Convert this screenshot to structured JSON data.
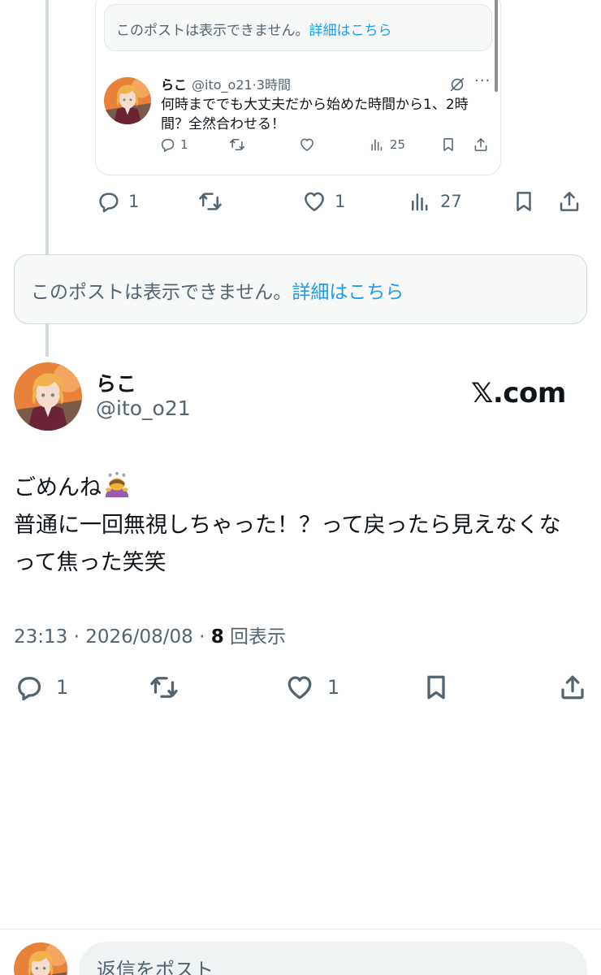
{
  "quoted_card": {
    "unavailable_text": "このポストは表示できません。",
    "unavailable_link": "詳細はこちら",
    "name": "らこ",
    "handle": "@ito_o21",
    "time": "3時間",
    "text": "何時まででも大丈夫だから始めた時間から1、2時間？全然合わせる！",
    "replies": "1",
    "views": "25"
  },
  "post1_actions": {
    "replies": "1",
    "likes": "1",
    "views": "27"
  },
  "unavailable_post": {
    "text": "このポストは表示できません。",
    "link": "詳細はこちら"
  },
  "main_post": {
    "name": "らこ",
    "handle": "@ito_o21",
    "brand": "𝕏.com",
    "text_line1": "ごめんね",
    "text_line2": "普通に一回無視しちゃった！？って戻ったら見えなくなって焦った笑笑",
    "timestamp": "23:13 · 2026/08/08 · ",
    "views_count": "8",
    "views_label": " 回表示",
    "replies": "1",
    "likes": "1"
  },
  "reply": {
    "placeholder": "返信をポスト"
  },
  "icons": [
    "reply-icon",
    "retweet-icon",
    "like-icon",
    "views-icon",
    "bookmark-icon",
    "share-icon",
    "grok-icon",
    "more-icon",
    "bowing-person-emoji"
  ],
  "colors": {
    "link": "#1d9bf0",
    "secondary_text": "#536471",
    "primary_text": "#0f1419",
    "card_bg": "#f7f9f9"
  }
}
